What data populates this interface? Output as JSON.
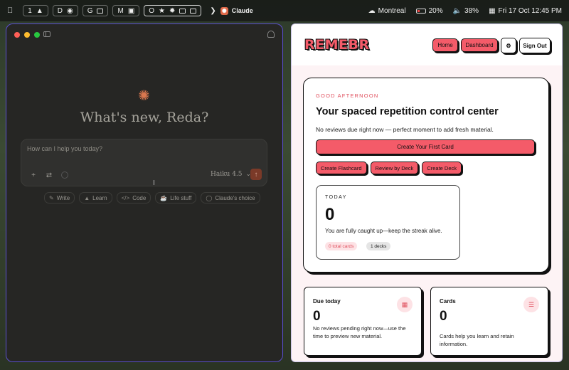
{
  "menubar": {
    "apple_icon": "apple-logo",
    "workspaces": [
      "1",
      "D",
      "G",
      "M",
      "O"
    ],
    "active_app": "Claude",
    "location": "Montreal",
    "battery": "20%",
    "volume": "38%",
    "datetime": "Fri 17 Oct 12:45 PM"
  },
  "claude": {
    "greeting": "What's new, Reda?",
    "input_placeholder": "How can I help you today?",
    "model": "Haiku 4.5",
    "chips": [
      "Write",
      "Learn",
      "Code",
      "Life stuff",
      "Claude's choice"
    ],
    "accent": "#d9774f"
  },
  "remebr": {
    "logo": "REMEBR",
    "nav": {
      "home": "Home",
      "dashboard": "Dashboard",
      "signout": "Sign Out"
    },
    "hero": {
      "eyebrow": "GOOD AFTERNOON",
      "title": "Your spaced repetition control center",
      "subtitle": "No reviews due right now — perfect moment to add fresh material.",
      "cta_main": "Create Your First Card",
      "cta_buttons": [
        "Create Flashcard",
        "Review by Deck",
        "Create Deck"
      ]
    },
    "today": {
      "eyebrow": "TODAY",
      "count": "0",
      "message": "You are fully caught up—keep the streak alive.",
      "badge_cards": "0 total cards",
      "badge_decks": "1 decks"
    },
    "stats": {
      "due": {
        "title": "Due today",
        "count": "0",
        "desc": "No reviews pending right now—use the time to preview new material.",
        "icon": "calendar-icon"
      },
      "cards": {
        "title": "Cards",
        "count": "0",
        "desc": "Cards help you learn and retain information.",
        "icon": "list-icon"
      }
    },
    "accent": "#f45b69"
  }
}
